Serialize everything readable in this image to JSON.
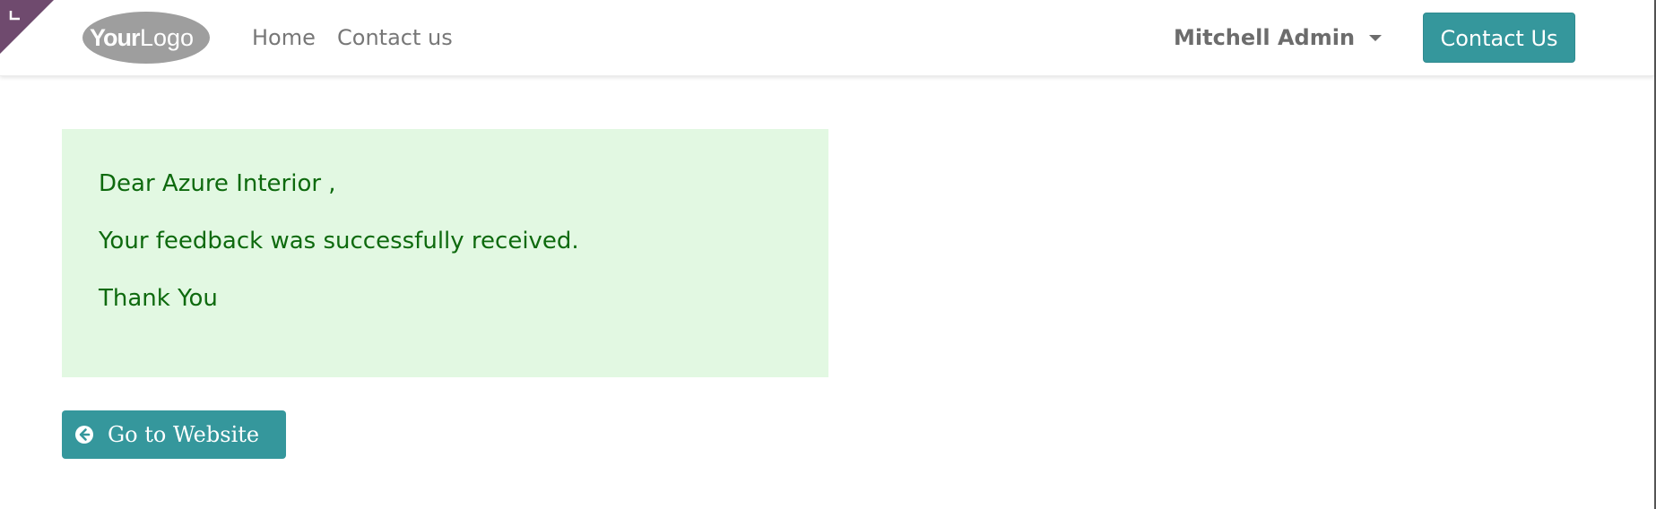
{
  "brand": {
    "logo_text_bold": "Your",
    "logo_text_light": "Logo",
    "logo_color": "#9e9e9e",
    "corner_color": "#6f4a6e"
  },
  "nav": {
    "items": [
      {
        "label": "Home"
      },
      {
        "label": "Contact us"
      }
    ]
  },
  "user": {
    "name": "Mitchell Admin"
  },
  "header_cta": {
    "label": "Contact Us",
    "color": "#35979c"
  },
  "message": {
    "greeting": "Dear Azure Interior ,",
    "body": "Your feedback was successfully received.",
    "closing": "Thank You",
    "background": "#e2f8e2",
    "text_color": "#0e6a0e"
  },
  "back_button": {
    "label": "Go to Website",
    "icon": "arrow-circle-left-icon"
  }
}
